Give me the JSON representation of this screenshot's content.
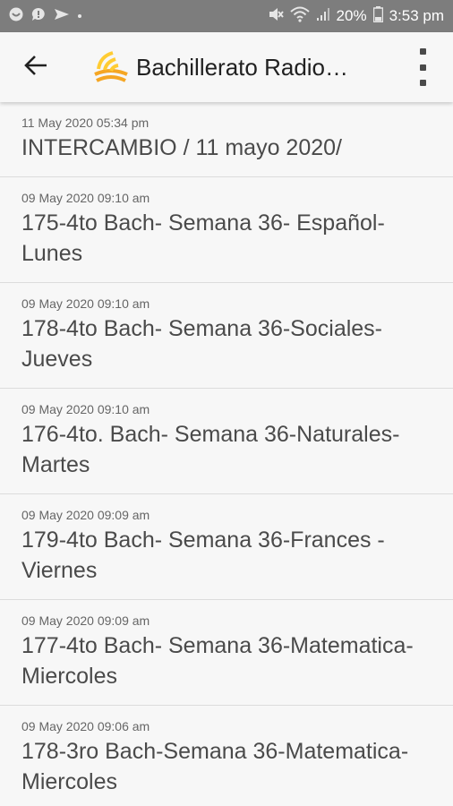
{
  "status_bar": {
    "battery": "20%",
    "time": "3:53 pm",
    "icons": [
      "notification-icon",
      "chat-icon",
      "send-icon",
      "dot-icon",
      "mute-icon",
      "wifi-icon",
      "signal-icon",
      "battery-icon"
    ]
  },
  "app_bar": {
    "title": "Bachillerato Radio…",
    "back_icon": "back-arrow-icon",
    "logo_icon": "radio-wave-logo",
    "menu_icon": "overflow-menu-icon"
  },
  "items": [
    {
      "date": "11 May 2020 05:34 pm",
      "title": "INTERCAMBIO / 11 mayo 2020/"
    },
    {
      "date": "09 May 2020 09:10 am",
      "title": "175-4to Bach- Semana 36- Español- Lunes"
    },
    {
      "date": "09 May 2020 09:10 am",
      "title": "178-4to Bach- Semana 36-Sociales- Jueves"
    },
    {
      "date": "09 May 2020 09:10 am",
      "title": "176-4to. Bach- Semana 36-Naturales- Martes"
    },
    {
      "date": "09 May 2020 09:09 am",
      "title": "179-4to Bach- Semana 36-Frances - Viernes"
    },
    {
      "date": "09 May 2020 09:09 am",
      "title": "177-4to Bach- Semana 36-Matematica- Miercoles"
    },
    {
      "date": "09 May 2020 09:06 am",
      "title": "178-3ro Bach-Semana 36-Matematica-Miercoles"
    }
  ],
  "colors": {
    "status_bar": "#7d7d7d",
    "background": "#f7f7f7",
    "logo_orange": "#f5a623",
    "logo_yellow": "#ffcc33"
  }
}
